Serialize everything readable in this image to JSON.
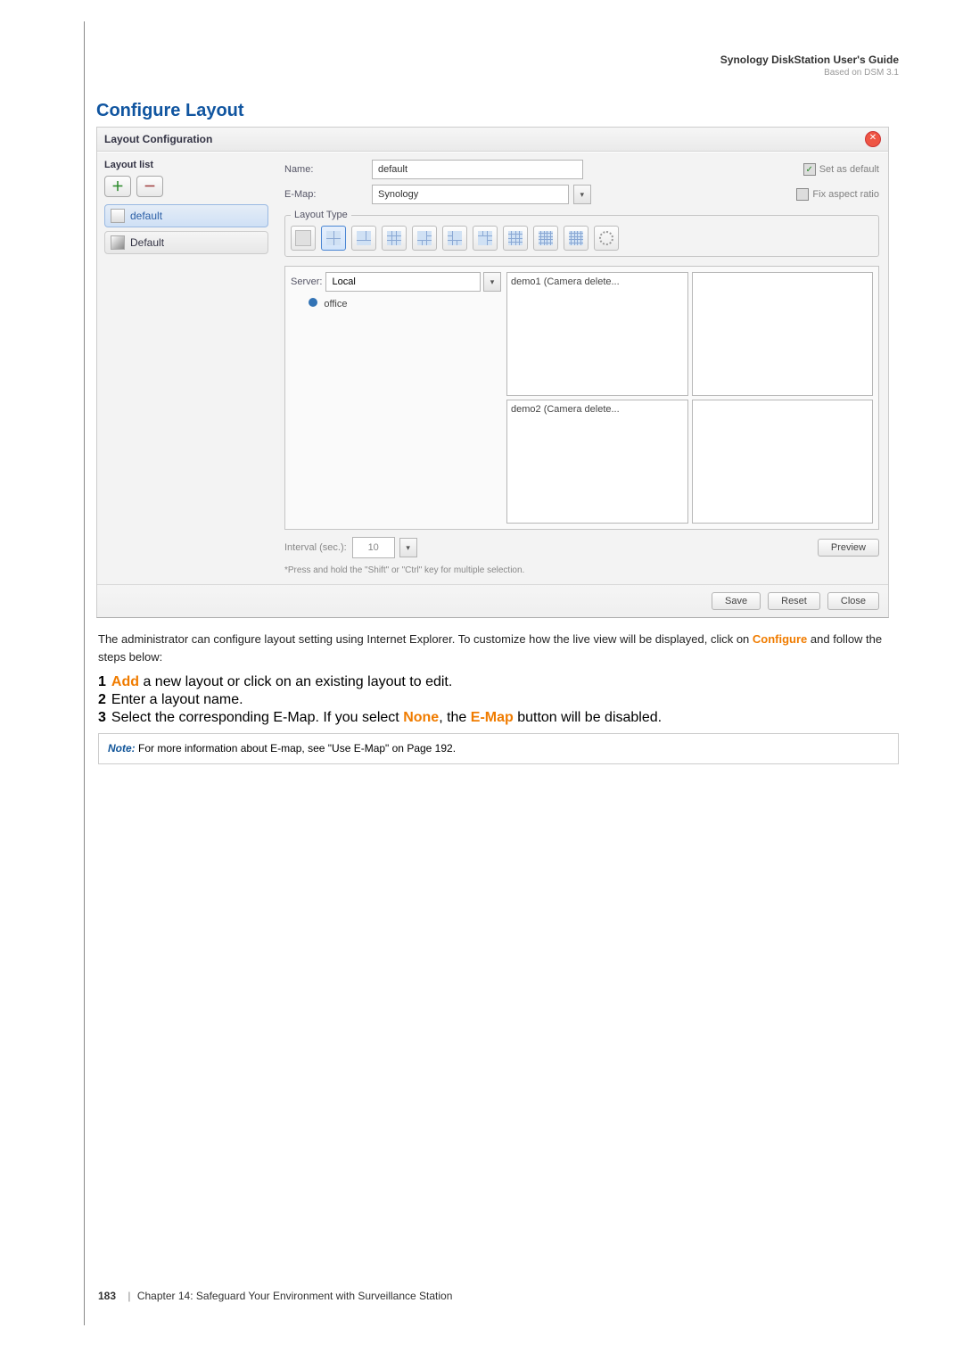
{
  "header": {
    "guide": "Synology DiskStation User's Guide",
    "based_on": "Based on DSM 3.1"
  },
  "section_title": "Configure Layout",
  "dialog": {
    "title": "Layout Configuration",
    "sidebar": {
      "heading": "Layout list",
      "items": [
        {
          "name": "default",
          "selected": true
        },
        {
          "name": "Default",
          "selected": false
        }
      ]
    },
    "fields": {
      "name_label": "Name:",
      "name_value": "default",
      "emap_label": "E-Map:",
      "emap_value": "Synology",
      "set_default": "Set as default",
      "set_default_checked": true,
      "fix_aspect": "Fix aspect ratio",
      "fix_aspect_checked": false,
      "layout_type_label": "Layout Type"
    },
    "server": {
      "label": "Server:",
      "value": "Local",
      "camera_item": "office"
    },
    "cells": [
      "demo1 (Camera delete...",
      "",
      "demo2 (Camera delete...",
      ""
    ],
    "interval": {
      "label": "Interval (sec.):",
      "value": "10"
    },
    "preview_btn": "Preview",
    "hint": "*Press and hold the \"Shift\" or \"Ctrl\" key for multiple selection.",
    "footer": {
      "save": "Save",
      "reset": "Reset",
      "close": "Close"
    }
  },
  "body": {
    "intro_1": "The administrator can configure layout setting using Internet Explorer. To customize how the live view will be displayed, click on ",
    "intro_conf": "Configure",
    "intro_2": " and follow the steps below:",
    "steps": {
      "s1_add": "Add",
      "s1_rest": " a new layout or click on an existing layout to edit.",
      "s2": "Enter a layout name.",
      "s3_a": "Select the corresponding E-Map. If you select ",
      "s3_none": "None",
      "s3_b": ", the ",
      "s3_emap": "E-Map",
      "s3_c": " button will be disabled."
    },
    "note_label": "Note:",
    "note_text": " For more information about E-map, see \"Use E-Map\" on Page 192."
  },
  "footer": {
    "page_no": "183",
    "chapter": "Chapter 14: Safeguard Your Environment with Surveillance Station"
  }
}
